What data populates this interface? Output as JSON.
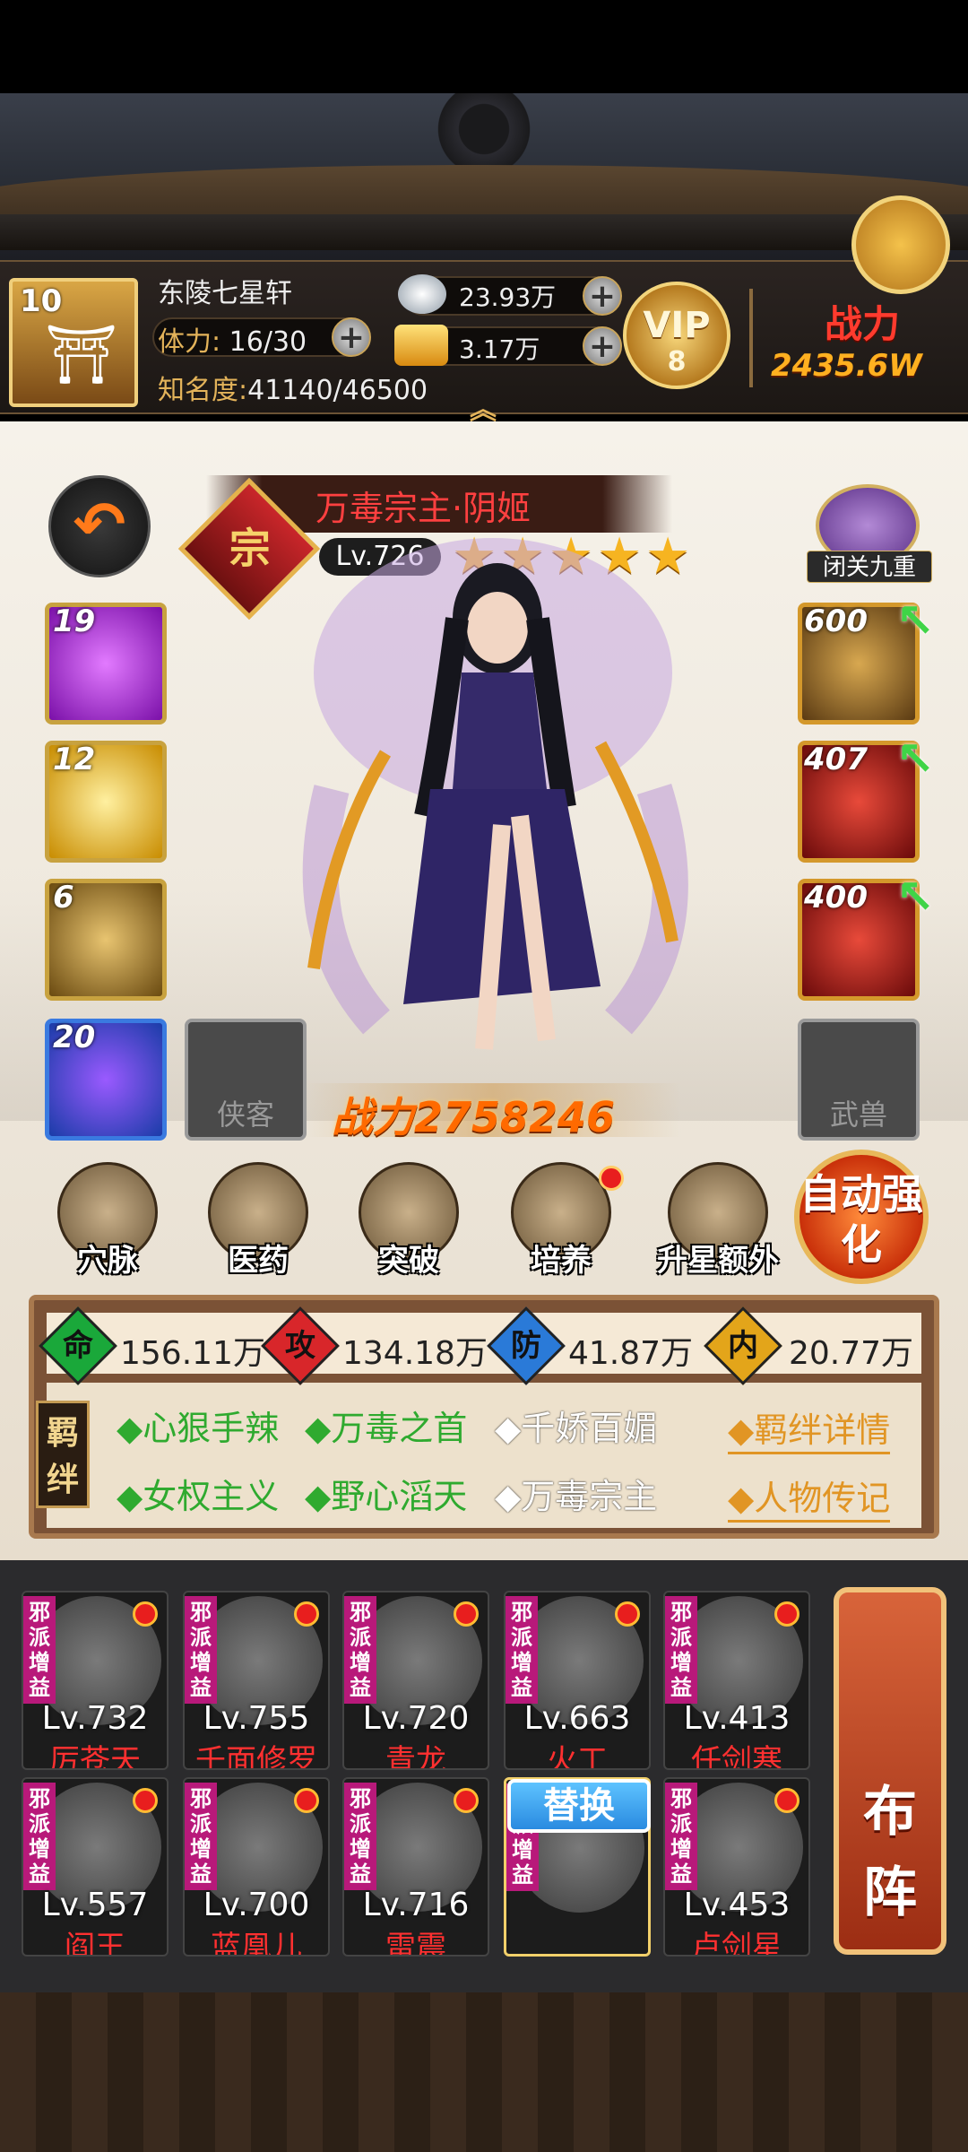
{
  "header": {
    "level": "10",
    "guild_name": "东陵七星轩",
    "stamina_label": "体力:",
    "stamina_value": "16/30",
    "fame_label": "知名度:",
    "fame_value": "41140/46500",
    "silver": "23.93万",
    "gold": "3.17万",
    "vip_label": "VIP",
    "vip_level": "8",
    "power_label": "战力",
    "power_value": "2435.6W"
  },
  "hero": {
    "name": "万毒宗主·阴姬",
    "rank_char": "宗",
    "level": "Lv.726",
    "stars": 5,
    "combat_power": "战力2758246",
    "retreat_label": "闭关九重"
  },
  "skills": [
    {
      "num": "19",
      "color": "#a01fd0"
    },
    {
      "num": "12",
      "color": "#e8b400"
    },
    {
      "num": "6",
      "color": "#d39a20"
    },
    {
      "num": "20",
      "color": "#1a5fd0"
    }
  ],
  "equips": [
    {
      "num": "600",
      "color": "#8a5f1c"
    },
    {
      "num": "407",
      "color": "#c01010"
    },
    {
      "num": "400",
      "color": "#c01010"
    }
  ],
  "slots": {
    "xiake": "侠客",
    "wushou": "武兽"
  },
  "actions": [
    {
      "label": "穴脉",
      "dot": false
    },
    {
      "label": "医药",
      "dot": false
    },
    {
      "label": "突破",
      "dot": false
    },
    {
      "label": "培养",
      "dot": true
    },
    {
      "label": "升星额外",
      "dot": false
    }
  ],
  "auto_label": "自动强化",
  "stats": [
    {
      "icon": "命",
      "value": "156.11万",
      "color": "#1aa83a"
    },
    {
      "icon": "攻",
      "value": "134.18万",
      "color": "#d8262a"
    },
    {
      "icon": "防",
      "value": "41.87万",
      "color": "#2a7ad8"
    },
    {
      "icon": "内",
      "value": "20.77万",
      "color": "#e3a51a"
    }
  ],
  "bond_label": "羁绊",
  "bonds_row1": [
    {
      "text": "◆心狠手辣",
      "active": true
    },
    {
      "text": "◆万毒之首",
      "active": true
    },
    {
      "text": "◆千娇百媚",
      "active": false
    }
  ],
  "bonds_row2": [
    {
      "text": "◆女权主义",
      "active": true
    },
    {
      "text": "◆野心滔天",
      "active": true
    },
    {
      "text": "◆万毒宗主",
      "active": false
    }
  ],
  "bond_links": [
    "◆羁绊详情",
    "◆人物传记"
  ],
  "team_tag": "邪派增益",
  "team": [
    {
      "lv": "Lv.732",
      "name": "厉苍天"
    },
    {
      "lv": "Lv.755",
      "name": "千面修罗"
    },
    {
      "lv": "Lv.720",
      "name": "青龙"
    },
    {
      "lv": "Lv.663",
      "name": "火工"
    },
    {
      "lv": "Lv.413",
      "name": "任剑寒"
    },
    {
      "lv": "Lv.557",
      "name": "阎王"
    },
    {
      "lv": "Lv.700",
      "name": "蓝凰儿"
    },
    {
      "lv": "Lv.716",
      "name": "雷震"
    },
    {
      "lv": "",
      "name": ""
    },
    {
      "lv": "Lv.453",
      "name": "卢剑星"
    }
  ],
  "swap_label": "替换",
  "formation_label": "布阵"
}
